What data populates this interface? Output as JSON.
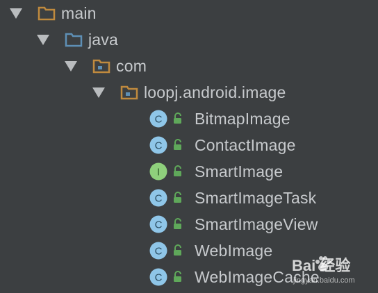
{
  "tree": {
    "items": [
      {
        "label": "main",
        "kind": "folder",
        "icon": "folder-icon",
        "expanded": true
      },
      {
        "label": "java",
        "kind": "source-folder",
        "icon": "source-folder-icon",
        "expanded": true
      },
      {
        "label": "com",
        "kind": "package",
        "icon": "package-icon",
        "expanded": true
      },
      {
        "label": "loopj.android.image",
        "kind": "package",
        "icon": "package-icon",
        "expanded": true
      },
      {
        "label": "BitmapImage",
        "kind": "class",
        "icon": "class-icon",
        "badge": "C"
      },
      {
        "label": "ContactImage",
        "kind": "class",
        "icon": "class-icon",
        "badge": "C"
      },
      {
        "label": "SmartImage",
        "kind": "interface",
        "icon": "interface-icon",
        "badge": "I"
      },
      {
        "label": "SmartImageTask",
        "kind": "class",
        "icon": "class-icon",
        "badge": "C"
      },
      {
        "label": "SmartImageView",
        "kind": "class",
        "icon": "class-icon",
        "badge": "C"
      },
      {
        "label": "WebImage",
        "kind": "class",
        "icon": "class-icon",
        "badge": "C"
      },
      {
        "label": "WebImageCache",
        "kind": "class",
        "icon": "class-icon",
        "badge": "C"
      }
    ]
  },
  "watermark": {
    "text": "Bai 经验",
    "subtext": "jingyan.baidu.com"
  },
  "colors": {
    "background": "#3c3f41",
    "text": "#c7cacd",
    "folder_orange": "#c08a3e",
    "folder_blue": "#5e8fb5",
    "class_blue": "#8fc6e8",
    "interface_green": "#8fd07c",
    "lock_green": "#5fa85a"
  }
}
